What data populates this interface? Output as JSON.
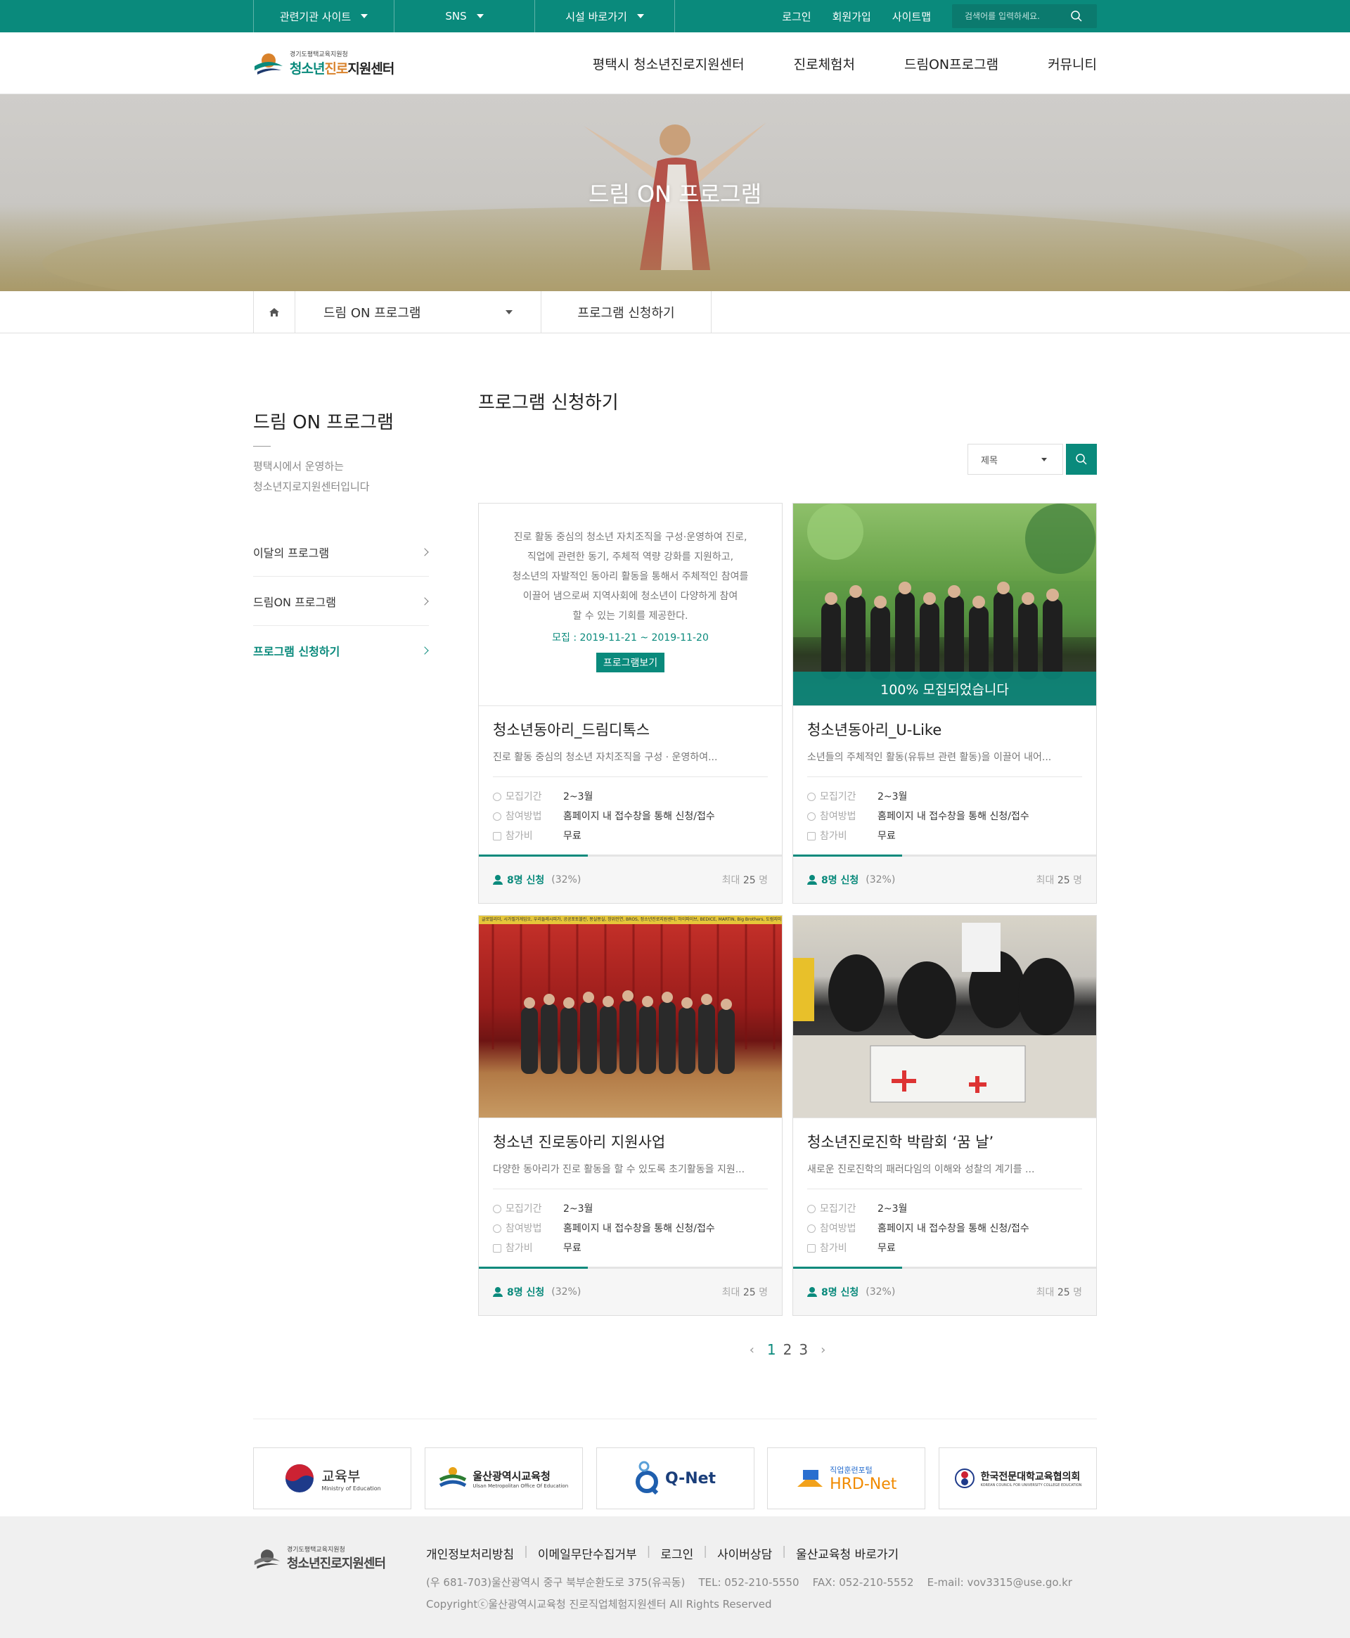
{
  "topbar": {
    "dropdowns": [
      "관련기관 사이트",
      "SNS",
      "시설 바로가기"
    ],
    "links": [
      "로그인",
      "회원가입",
      "사이트맵"
    ],
    "search_placeholder": "검색어를 입력하세요."
  },
  "header": {
    "logo_small": "경기도평택교육지원청",
    "logo_name_a": "청소년",
    "logo_name_b": "진로",
    "logo_name_c": "지원센터",
    "nav": [
      "평택시 청소년진로지원센터",
      "진로체험처",
      "드림ON프로그램",
      "커뮤니티"
    ]
  },
  "hero": {
    "title": "드림 ON 프로그램"
  },
  "breadcrumb": {
    "level1": "드림 ON 프로그램",
    "level2": "프로그램 신청하기"
  },
  "sidebar": {
    "title": "드림 ON 프로그램",
    "desc_line1": "평택시에서 운영하는",
    "desc_line2": "청소년지로지원센터입니다",
    "items": [
      {
        "label": "이달의 프로그램"
      },
      {
        "label": "드림ON 프로그램"
      },
      {
        "label": "프로그램 신청하기"
      }
    ]
  },
  "main": {
    "title": "프로그램 신청하기",
    "search_select": "제목"
  },
  "cards": [
    {
      "intro_lines": [
        "진로 활동 중심의 청소년 자치조직을 구성·운영하여 진로,",
        "직업에 관련한 동기, 주체적 역량 강화를 지원하고,",
        "청소년의 자발적인 동아리 활동을 통해서 주체적인 참여를",
        "이끌어 냄으로써 지역사회에 청소년이 다양하게 참여",
        "할 수 있는 기회를 제공한다."
      ],
      "intro_period": "모집 : 2019-11-21 ~ 2019-11-20",
      "intro_button": "프로그램보기",
      "title": "청소년동아리_드림디톡스",
      "desc": "진로 활동 중심의 청소년 자치조직을 구성 · 운영하여...",
      "period_label": "모집기간",
      "period": "2~3월",
      "method_label": "참여방법",
      "method": "홈페이지 내 접수창을 통해 신청/접수",
      "fee_label": "참가비",
      "fee": "무료",
      "applied": "8명 신청",
      "pct": "(32%)",
      "progress": 0.36,
      "max_label": "최대",
      "max_num": "25",
      "max_unit": "명"
    },
    {
      "overlay": "100% 모집되었습니다",
      "title": "청소년동아리_U-Like",
      "desc": "소년들의 주체적인 활동(유튜브 관련 활동)을 이끌어 내어...",
      "period_label": "모집기간",
      "period": "2~3월",
      "method_label": "참여방법",
      "method": "홈페이지 내 접수창을 통해 신청/접수",
      "fee_label": "참가비",
      "fee": "무료",
      "applied": "8명 신청",
      "pct": "(32%)",
      "progress": 0.36,
      "max_label": "최대",
      "max_num": "25",
      "max_unit": "명"
    },
    {
      "strip": "글로벌리더, 시가필가게임오, 우리들레시피가, 공공포토블린, 몽실몽실, 창위인연, BROS, 정소년진로지원센터, 하이파이브, BEDICE, MARTIN, Big Brothers, 도럼지미 U-Like, MC-RUN",
      "title": "청소년 진로동아리 지원사업",
      "desc": "다양한 동아리가 진로 활동을 할 수 있도록 초기활동을 지원...",
      "period_label": "모집기간",
      "period": "2~3월",
      "method_label": "참여방법",
      "method": "홈페이지 내 접수창을 통해 신청/접수",
      "fee_label": "참가비",
      "fee": "무료",
      "applied": "8명 신청",
      "pct": "(32%)",
      "progress": 0.36,
      "max_label": "최대",
      "max_num": "25",
      "max_unit": "명"
    },
    {
      "title": "청소년진로진학 박람회 ‘꿈 날’",
      "desc": "새로운 진로진학의 패러다임의 이해와 성찰의 계기를 ...",
      "period_label": "모집기간",
      "period": "2~3월",
      "method_label": "참여방법",
      "method": "홈페이지 내 접수창을 통해 신청/접수",
      "fee_label": "참가비",
      "fee": "무료",
      "applied": "8명 신청",
      "pct": "(32%)",
      "progress": 0.36,
      "max_label": "최대",
      "max_num": "25",
      "max_unit": "명"
    }
  ],
  "pagination": [
    "1",
    "2",
    "3"
  ],
  "partners": [
    {
      "name": "교육부",
      "sub": "Ministry of Education"
    },
    {
      "name": "울산광역시교육청",
      "sub": "Ulsan Metropolitan Office Of Education"
    },
    {
      "name": "Q-Net",
      "sub": ""
    },
    {
      "name": "HRD-Net",
      "sub": "직업훈련포털"
    },
    {
      "name": "한국전문대학교육협의회",
      "sub": "KOREAN COUNCIL FOR UNIVERSITY COLLEGE EDUCATION"
    }
  ],
  "footer": {
    "logo_small": "경기도평택교육지원청",
    "logo_name": "청소년진로지원센터",
    "links": [
      "개인정보처리방침",
      "이메일무단수집거부",
      "로그인",
      "사이버상담",
      "울산교육청 바로가기"
    ],
    "address": "(우 681-703)울산광역시 중구 북부순환도로 375(유곡동)",
    "tel": "TEL: 052-210-5550",
    "fax": "FAX: 052-210-5552",
    "email": "E-mail: vov3315@use.go.kr",
    "copyright": "Copyrightⓒ울산광역시교육청 진로직업체험지원센터 All Rights Reserved"
  },
  "colors": {
    "accent": "#0a8a7c",
    "logo_orange": "#d9822b"
  }
}
